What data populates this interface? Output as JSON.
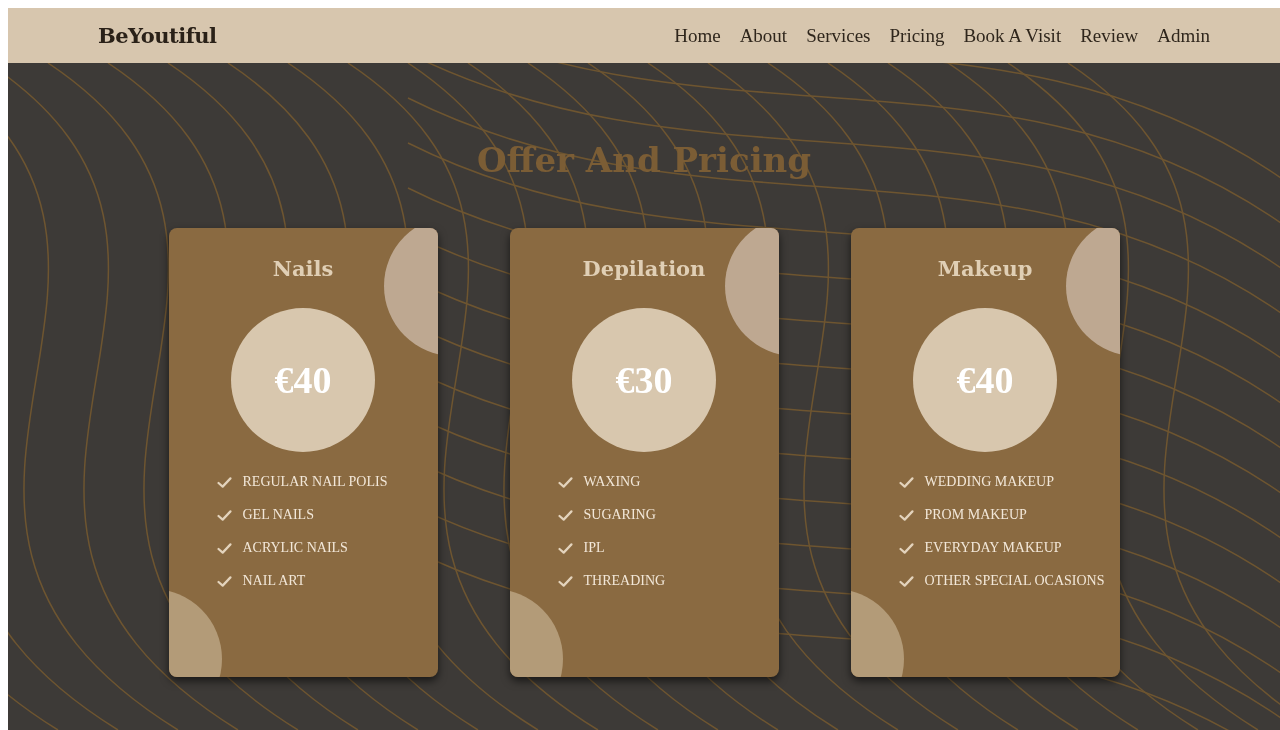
{
  "brand": "BeYoutiful",
  "nav": [
    {
      "label": "Home"
    },
    {
      "label": "About"
    },
    {
      "label": "Services"
    },
    {
      "label": "Pricing"
    },
    {
      "label": "Book A Visit"
    },
    {
      "label": "Review"
    },
    {
      "label": "Admin"
    }
  ],
  "heading": "Offer And Pricing",
  "plans": [
    {
      "title": "Nails",
      "price": "€40",
      "features": [
        "REGULAR NAIL POLIS",
        "GEL NAILS",
        "ACRYLIC NAILS",
        "NAIL ART"
      ]
    },
    {
      "title": "Depilation",
      "price": "€30",
      "features": [
        "WAXING",
        "SUGARING",
        "IPL",
        "THREADING"
      ]
    },
    {
      "title": "Makeup",
      "price": "€40",
      "features": [
        "WEDDING MAKEUP",
        "PROM MAKEUP",
        "EVERYDAY MAKEUP",
        "OTHER SPECIAL OCASIONS"
      ]
    }
  ]
}
